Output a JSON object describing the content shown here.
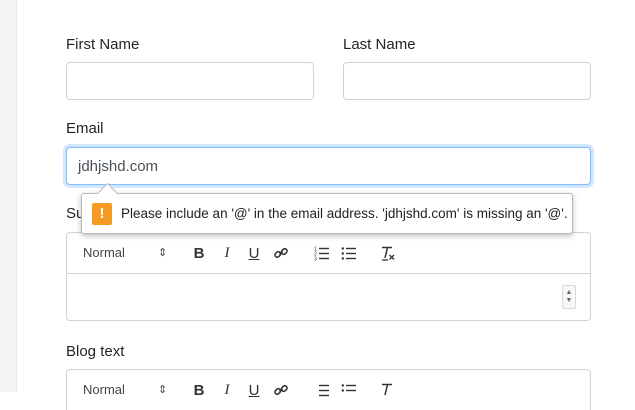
{
  "form": {
    "first_name": {
      "label": "First Name",
      "value": ""
    },
    "last_name": {
      "label": "Last Name",
      "value": ""
    },
    "email": {
      "label": "Email",
      "value": "jdhjshd.com"
    },
    "subject": {
      "label_visible_prefix": "Su"
    },
    "blog_text": {
      "label": "Blog text"
    }
  },
  "validation_tooltip": {
    "icon": "!",
    "message": "Please include an '@' in the email address. 'jdhjshd.com' is missing an '@'."
  },
  "editor_toolbar": {
    "format_select": "Normal",
    "select_caret": "⇕",
    "bold": "B",
    "italic": "I",
    "underline": "U",
    "link_icon": "link-icon",
    "ordered_list_icon": "ordered-list-icon",
    "bullet_list_icon": "bullet-list-icon",
    "clean_icon": "clear-format-icon"
  },
  "colors": {
    "warning_badge": "#f59a23",
    "focus_border": "#80bdff"
  }
}
